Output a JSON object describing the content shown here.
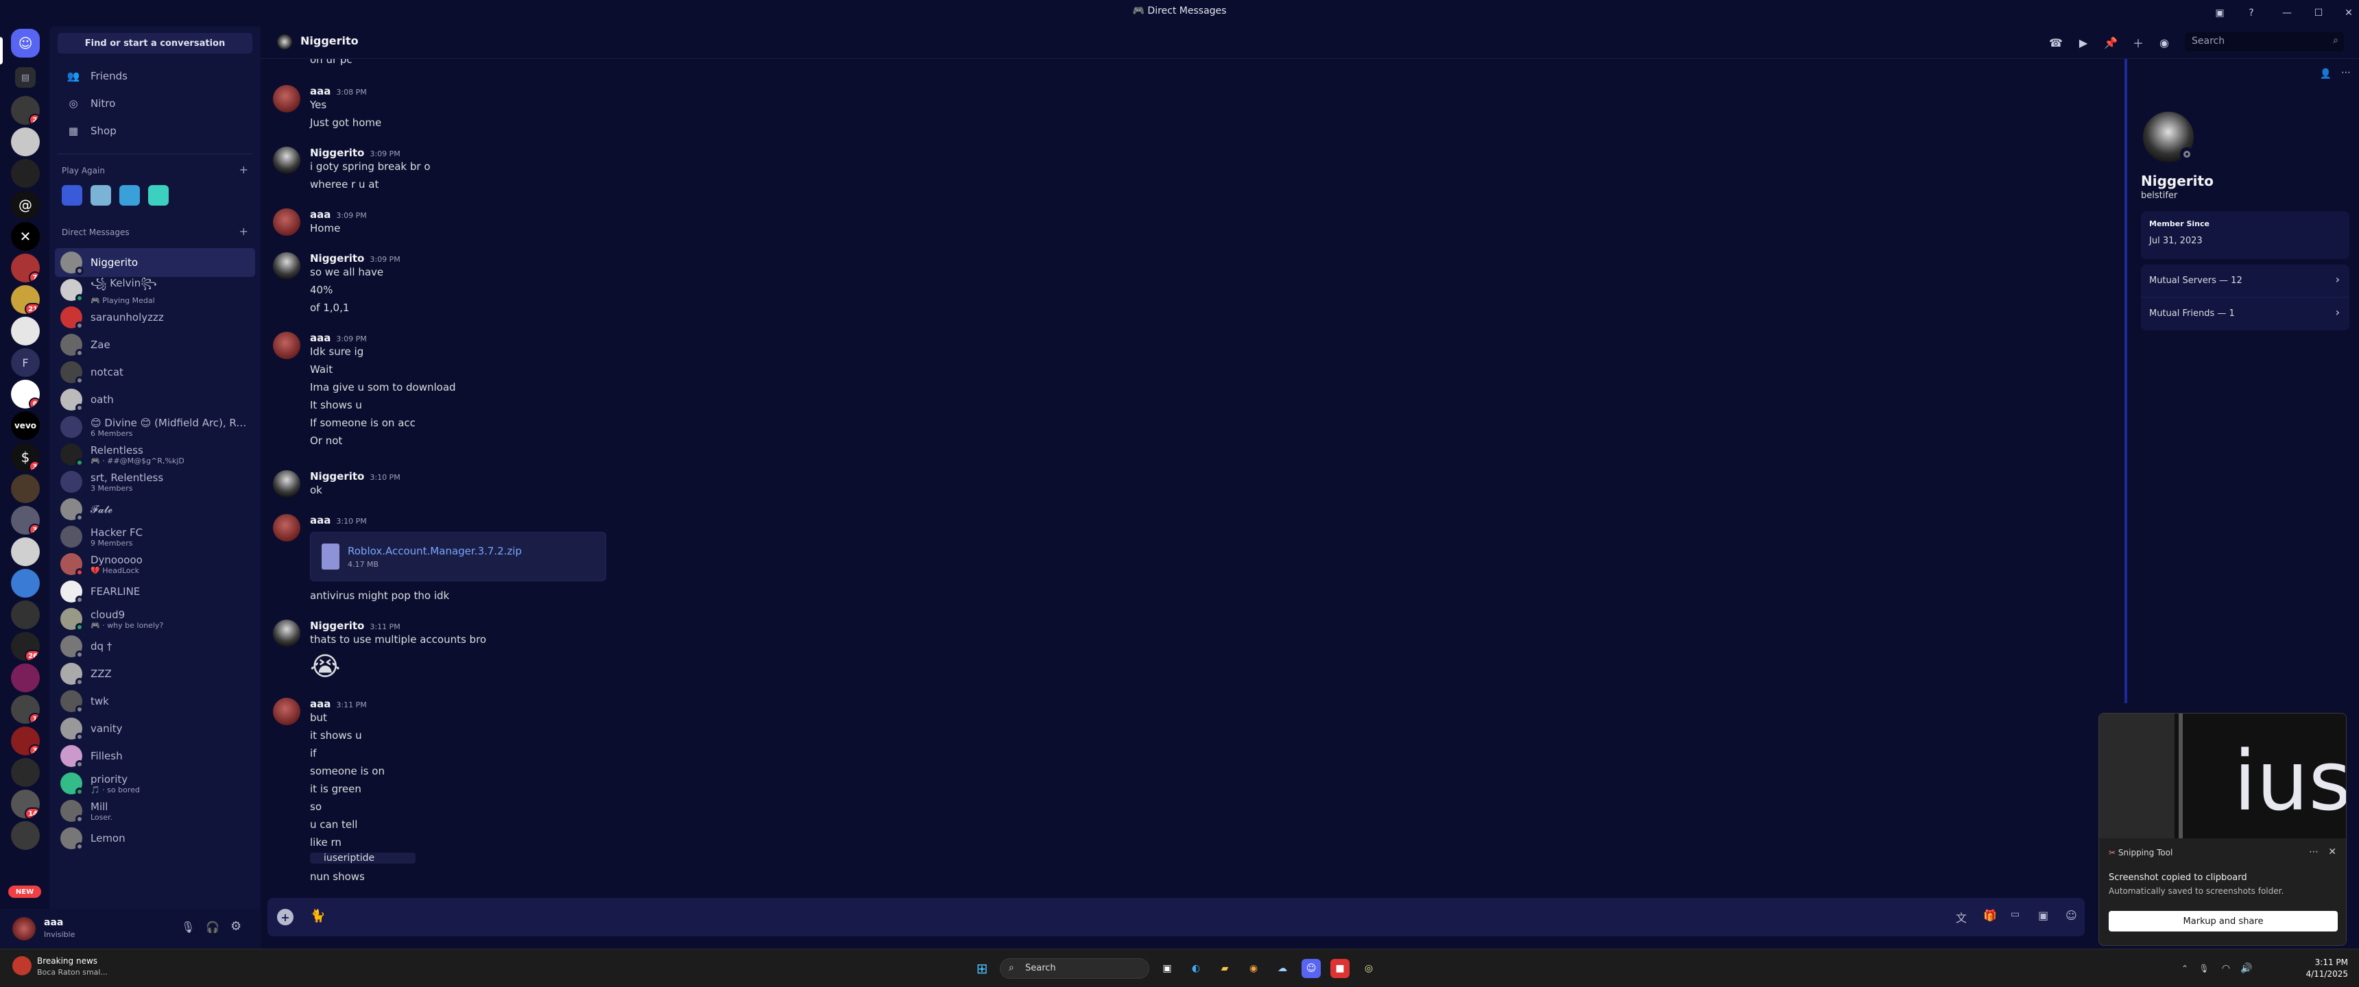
{
  "window": {
    "title": "Direct Messages"
  },
  "dm_panel": {
    "find_label": "Find or start a conversation",
    "nav": [
      {
        "label": "Friends"
      },
      {
        "label": "Nitro"
      },
      {
        "label": "Shop"
      }
    ],
    "play_again_label": "Play Again",
    "direct_messages_label": "Direct Messages",
    "dms": [
      {
        "name": "Niggerito",
        "sub": ""
      },
      {
        "name": "꧁ Kelvin꧂",
        "sub": "🎮 Playing Medal"
      },
      {
        "name": "saraunholyzzz",
        "sub": ""
      },
      {
        "name": "Zae",
        "sub": ""
      },
      {
        "name": "notcat",
        "sub": ""
      },
      {
        "name": "oath",
        "sub": ""
      },
      {
        "name": "😊 Divine 😊 (Midfield Arc), Rel...",
        "sub": "6 Members"
      },
      {
        "name": "Relentless",
        "sub": "🎮 · ##@M@$g^R,%kjD"
      },
      {
        "name": "srt, Relentless",
        "sub": "3 Members"
      },
      {
        "name": "𝓕𝓪𝓽𝓮",
        "sub": ""
      },
      {
        "name": "Hacker FC",
        "sub": "9 Members"
      },
      {
        "name": "Dynooooo",
        "sub": "💔 HeadLock"
      },
      {
        "name": "FEARLINE",
        "sub": ""
      },
      {
        "name": "cloud9",
        "sub": "🎮 · why be lonely?"
      },
      {
        "name": "dq †",
        "sub": ""
      },
      {
        "name": "ZZZ",
        "sub": ""
      },
      {
        "name": "twk",
        "sub": ""
      },
      {
        "name": "vanity",
        "sub": ""
      },
      {
        "name": "Fillesh",
        "sub": ""
      },
      {
        "name": "priority",
        "sub": "🎵 · so bored"
      },
      {
        "name": "Mill",
        "sub": "Loser."
      },
      {
        "name": "Lemon",
        "sub": ""
      }
    ]
  },
  "user": {
    "name": "aaa",
    "status": "Invisible"
  },
  "rail": {
    "new_label": "NEW",
    "dm_initial": "F",
    "vevo_label": "vevo",
    "badges": [
      "2",
      "7",
      "21",
      "6",
      "3",
      "3",
      "26",
      "1",
      "3",
      "14"
    ]
  },
  "chat": {
    "recipient": "Niggerito",
    "search_placeholder": "Search",
    "top_line": "on ur pc",
    "messages": [
      {
        "author": "aaa",
        "time": "3:08 PM",
        "lines": [
          "Yes",
          "Just got home"
        ]
      },
      {
        "author": "Niggerito",
        "time": "3:09 PM",
        "lines": [
          "i goty spring break br o",
          "wheree r u at"
        ]
      },
      {
        "author": "aaa",
        "time": "3:09 PM",
        "lines": [
          "Home"
        ]
      },
      {
        "author": "Niggerito",
        "time": "3:09 PM",
        "lines": [
          "so we all have",
          "40%",
          "of 1,0,1"
        ]
      },
      {
        "author": "aaa",
        "time": "3:09 PM",
        "lines": [
          "Idk sure ig",
          "Wait",
          "Ima give u som to download",
          "It shows u",
          "If someone is on acc",
          "Or not"
        ]
      },
      {
        "author": "Niggerito",
        "time": "3:10 PM",
        "lines": [
          "ok"
        ]
      },
      {
        "author": "aaa",
        "time": "3:10 PM",
        "lines": [
          "antivirus might pop tho idk"
        ]
      },
      {
        "author": "Niggerito",
        "time": "3:11 PM",
        "lines": [
          "thats to use multiple accounts bro",
          "😭"
        ]
      },
      {
        "author": "aaa",
        "time": "3:11 PM",
        "lines": [
          "but",
          "it shows u",
          "if",
          "someone is on",
          "it is green",
          "so",
          "u can tell",
          "like rn",
          "iuseriptide",
          "nun shows"
        ]
      }
    ],
    "attachment": {
      "file_name": "Roblox.Account.Manager.3.7.2.zip",
      "size": "4.17 MB"
    }
  },
  "profile": {
    "display_name": "Niggerito",
    "username": "belstifer",
    "member_since_label": "Member Since",
    "member_since": "Jul 31, 2023",
    "mutual_servers": "Mutual Servers — 12",
    "mutual_friends": "Mutual Friends — 1"
  },
  "snip": {
    "app": "Snipping Tool",
    "title": "Screenshot copied to clipboard",
    "body": "Automatically saved to screenshots folder.",
    "button": "Markup and share",
    "preview_text": "ius"
  },
  "taskbar": {
    "news_title": "Breaking news",
    "news_sub": "Boca Raton smal...",
    "search_placeholder": "Search",
    "time": "3:11 PM",
    "date": "4/11/2025"
  }
}
